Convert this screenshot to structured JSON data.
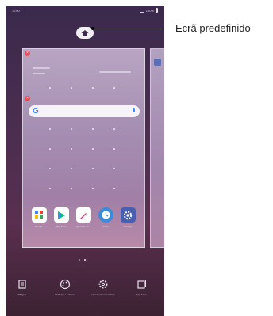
{
  "status_bar": {
    "time": "11:00",
    "battery": "100%"
  },
  "callout": {
    "label": "Ecrã predefinido"
  },
  "home_screen": {
    "widget_line1": "Tap to add weather",
    "widget_line2": "Mon, 6/11",
    "dock_apps": [
      {
        "label": "Google",
        "icon": "google-folder-icon",
        "color": "#ffffff"
      },
      {
        "label": "Play Store",
        "icon": "play-store-icon",
        "color": "#ffffff"
      },
      {
        "label": "QuickMemo+",
        "icon": "quickmemo-icon",
        "color": "#ffffff"
      },
      {
        "label": "Clock",
        "icon": "clock-icon",
        "color": "#3d8bd8"
      },
      {
        "label": "Settings",
        "icon": "settings-icon",
        "color": "#4a5fb0"
      }
    ]
  },
  "toolbar": {
    "items": [
      {
        "label": "Widgets",
        "icon": "widgets-icon"
      },
      {
        "label": "Wallpaper & theme",
        "icon": "palette-icon"
      },
      {
        "label": "Home screen settings",
        "icon": "gear-icon"
      },
      {
        "label": "App trays",
        "icon": "app-trays-icon"
      }
    ]
  }
}
